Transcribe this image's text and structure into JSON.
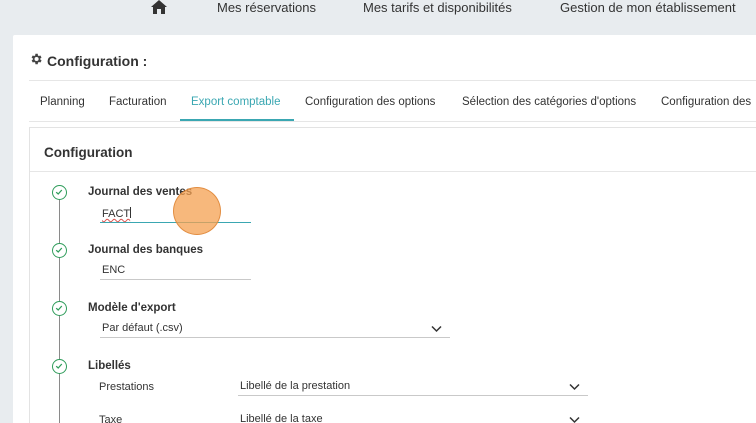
{
  "topnav": {
    "home_icon": "home-icon",
    "links": [
      "Mes réservations",
      "Mes tarifs et disponibilités",
      "Gestion de mon établissement"
    ]
  },
  "config": {
    "title": "Configuration :",
    "icon": "gear-icon"
  },
  "tabs": [
    {
      "label": "Planning",
      "active": false
    },
    {
      "label": "Facturation",
      "active": false
    },
    {
      "label": "Export comptable",
      "active": true
    },
    {
      "label": "Configuration des options",
      "active": false
    },
    {
      "label": "Sélection des catégories d'options",
      "active": false
    },
    {
      "label": "Configuration des",
      "active": false
    }
  ],
  "card": {
    "title": "Configuration",
    "sections": {
      "journal_ventes": {
        "label": "Journal des ventes",
        "value": "FACT"
      },
      "journal_banques": {
        "label": "Journal des banques",
        "value": "ENC"
      },
      "modele_export": {
        "label": "Modèle d'export",
        "value": "Par défaut (.csv)"
      },
      "libelles": {
        "label": "Libellés",
        "rows": [
          {
            "label": "Prestations",
            "value": "Libellé de la prestation"
          },
          {
            "label": "Taxe",
            "value": "Libellé de la taxe"
          }
        ]
      }
    }
  },
  "colors": {
    "accent": "#3aa7b2",
    "check": "#2e9c5a"
  }
}
